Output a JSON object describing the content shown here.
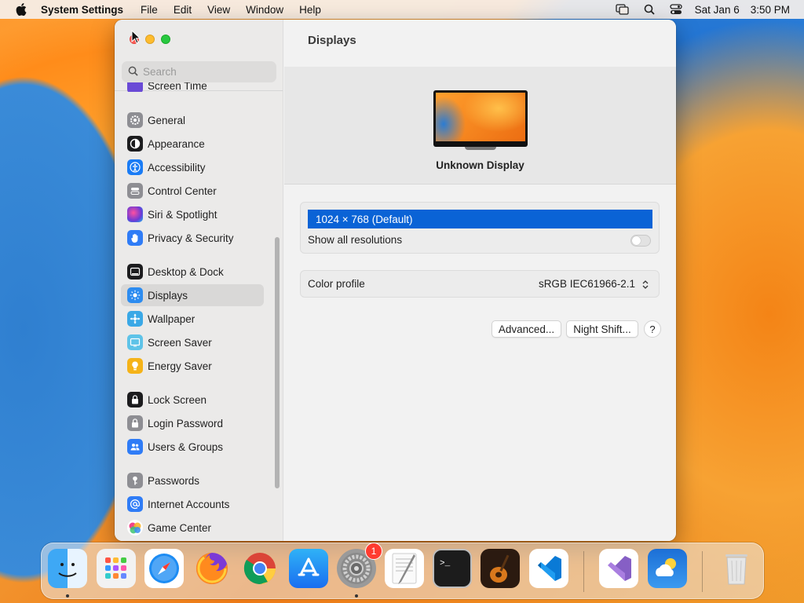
{
  "menubar": {
    "app_name": "System Settings",
    "menus": [
      "File",
      "Edit",
      "View",
      "Window",
      "Help"
    ],
    "date": "Sat Jan 6",
    "time": "3:50 PM"
  },
  "sidebar": {
    "search_placeholder": "Search",
    "partial_item": "Screen Time",
    "items": [
      {
        "label": "General",
        "icon": "gear-icon",
        "color": "#8e8e93"
      },
      {
        "label": "Appearance",
        "icon": "appearance-icon",
        "color": "#1c1c1e"
      },
      {
        "label": "Accessibility",
        "icon": "accessibility-icon",
        "color": "#1a7cf5"
      },
      {
        "label": "Control Center",
        "icon": "control-center-icon",
        "color": "#8e8e93"
      },
      {
        "label": "Siri & Spotlight",
        "icon": "siri-icon",
        "color": "#a14cd9"
      },
      {
        "label": "Privacy & Security",
        "icon": "hand-icon",
        "color": "#2f7cf6"
      },
      {
        "label": "Desktop & Dock",
        "icon": "dock-icon",
        "color": "#1c1c1e"
      },
      {
        "label": "Displays",
        "icon": "sun-icon",
        "color": "#2d8cf0"
      },
      {
        "label": "Wallpaper",
        "icon": "wallpaper-icon",
        "color": "#3aa8e6"
      },
      {
        "label": "Screen Saver",
        "icon": "screen-saver-icon",
        "color": "#5ec3e8"
      },
      {
        "label": "Energy Saver",
        "icon": "bulb-icon",
        "color": "#f5b318"
      },
      {
        "label": "Lock Screen",
        "icon": "lock-icon",
        "color": "#1c1c1e"
      },
      {
        "label": "Login Password",
        "icon": "key-lock-icon",
        "color": "#8e8e93"
      },
      {
        "label": "Users & Groups",
        "icon": "users-icon",
        "color": "#2f7cf6"
      },
      {
        "label": "Passwords",
        "icon": "key-icon",
        "color": "#8e8e93"
      },
      {
        "label": "Internet Accounts",
        "icon": "at-icon",
        "color": "#2f7cf6"
      },
      {
        "label": "Game Center",
        "icon": "game-center-icon",
        "color": "#f05a8a"
      }
    ],
    "selected": "Displays"
  },
  "main": {
    "title": "Displays",
    "display_name": "Unknown Display",
    "resolution_selected": "1024 × 768 (Default)",
    "show_all_label": "Show all resolutions",
    "show_all_on": false,
    "color_profile_label": "Color profile",
    "color_profile_value": "sRGB IEC61966-2.1",
    "advanced_label": "Advanced...",
    "night_shift_label": "Night Shift...",
    "help_label": "?"
  },
  "dock": {
    "apps": [
      {
        "name": "Finder",
        "icon": "finder-icon",
        "running": true
      },
      {
        "name": "Launchpad",
        "icon": "launchpad-icon",
        "running": false
      },
      {
        "name": "Safari",
        "icon": "safari-icon",
        "running": false
      },
      {
        "name": "Firefox",
        "icon": "firefox-icon",
        "running": false
      },
      {
        "name": "Chrome",
        "icon": "chrome-icon",
        "running": false
      },
      {
        "name": "App Store",
        "icon": "app-store-icon",
        "running": false
      },
      {
        "name": "System Settings",
        "icon": "system-settings-icon",
        "running": true,
        "badge": "1"
      },
      {
        "name": "TextEdit",
        "icon": "textedit-icon",
        "running": false
      },
      {
        "name": "Terminal",
        "icon": "terminal-icon",
        "running": false
      },
      {
        "name": "GarageBand",
        "icon": "garageband-icon",
        "running": false
      },
      {
        "name": "VS Code",
        "icon": "vscode-icon",
        "running": false
      },
      {
        "name": "Visual Studio",
        "icon": "visual-studio-icon",
        "running": false
      },
      {
        "name": "Weather",
        "icon": "weather-icon",
        "running": false
      },
      {
        "name": "Trash",
        "icon": "trash-icon",
        "running": false
      }
    ]
  }
}
